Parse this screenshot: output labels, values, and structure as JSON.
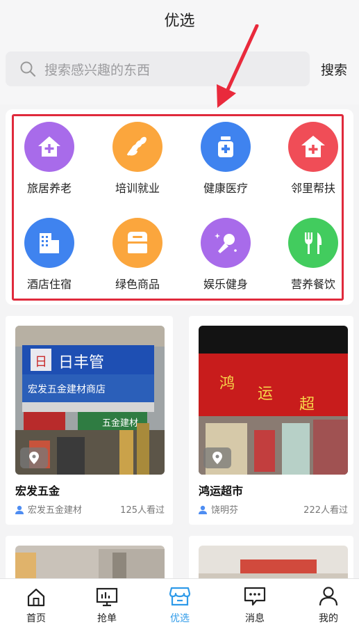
{
  "header": {
    "title": "优选"
  },
  "search": {
    "placeholder": "搜索感兴趣的东西",
    "button_label": "搜索"
  },
  "categories": [
    {
      "label": "旅居养老",
      "icon": "house-plus-icon",
      "color": "#a86bea"
    },
    {
      "label": "培训就业",
      "icon": "wheat-icon",
      "color": "#fba63d"
    },
    {
      "label": "健康医疗",
      "icon": "medicine-jar-icon",
      "color": "#3f83ef"
    },
    {
      "label": "邻里帮扶",
      "icon": "house-plus-icon",
      "color": "#f04d57"
    },
    {
      "label": "酒店住宿",
      "icon": "building-icon",
      "color": "#3f83ef"
    },
    {
      "label": "绿色商品",
      "icon": "box-icon",
      "color": "#fba63d"
    },
    {
      "label": "娱乐健身",
      "icon": "microphone-icon",
      "color": "#a86bea"
    },
    {
      "label": "营养餐饮",
      "icon": "fork-knife-icon",
      "color": "#42cc5e"
    }
  ],
  "shops": [
    {
      "name": "宏发五金",
      "owner": "宏发五金建材",
      "views": "125人看过"
    },
    {
      "name": "鸿运超市",
      "owner": "饶明芬",
      "views": "222人看过"
    }
  ],
  "tabs": [
    {
      "label": "首页",
      "icon": "home-icon"
    },
    {
      "label": "抢单",
      "icon": "monitor-icon"
    },
    {
      "label": "优选",
      "icon": "shop-icon"
    },
    {
      "label": "消息",
      "icon": "message-icon"
    },
    {
      "label": "我的",
      "icon": "person-icon"
    }
  ],
  "colors": {
    "accent": "#2e9ae9",
    "highlight_frame": "#e02a3c"
  }
}
